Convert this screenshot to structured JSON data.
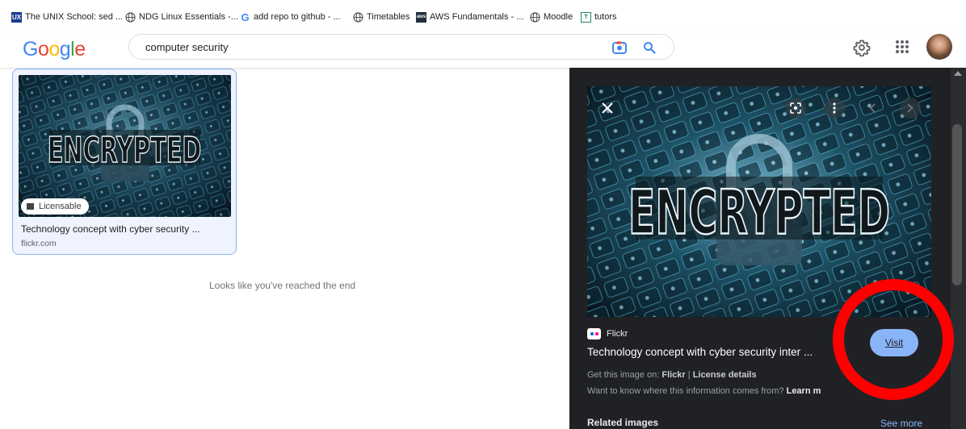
{
  "bookmarks": [
    {
      "icon": "unix-school-icon",
      "label": "The UNIX School: sed ..."
    },
    {
      "icon": "globe-icon",
      "label": "NDG Linux Essentials -..."
    },
    {
      "icon": "google-g-icon",
      "label": "add repo to github - ..."
    },
    {
      "icon": "globe-icon",
      "label": "Timetables"
    },
    {
      "icon": "aws-icon",
      "label": "AWS Fundamentals - ..."
    },
    {
      "icon": "globe-icon",
      "label": "Moodle"
    },
    {
      "icon": "tutors-icon",
      "label": "tutors"
    }
  ],
  "header": {
    "logo": "Google",
    "search_value": "computer security"
  },
  "result": {
    "image_text": "ENCRYPTED",
    "badge": "Licensable",
    "title": "Technology concept with cyber security ...",
    "source": "flickr.com"
  },
  "end_message": "Looks like you've reached the end",
  "panel": {
    "image_text": "ENCRYPTED",
    "source_name": "Flickr",
    "title": "Technology concept with cyber security inter",
    "title_ellipsis": "...",
    "get_prefix": "Get this image on:",
    "get_source": "Flickr",
    "get_sep": "|",
    "license_details": "License details",
    "want_text": "Want to know where this information comes from?",
    "learn_more": "Learn m",
    "visit_label": "Visit",
    "related_label": "Related images",
    "see_more": "See more"
  },
  "colors": {
    "accent_blue": "#8ab4f8",
    "panel_bg": "#202124",
    "annotation_red": "#ff0000"
  }
}
